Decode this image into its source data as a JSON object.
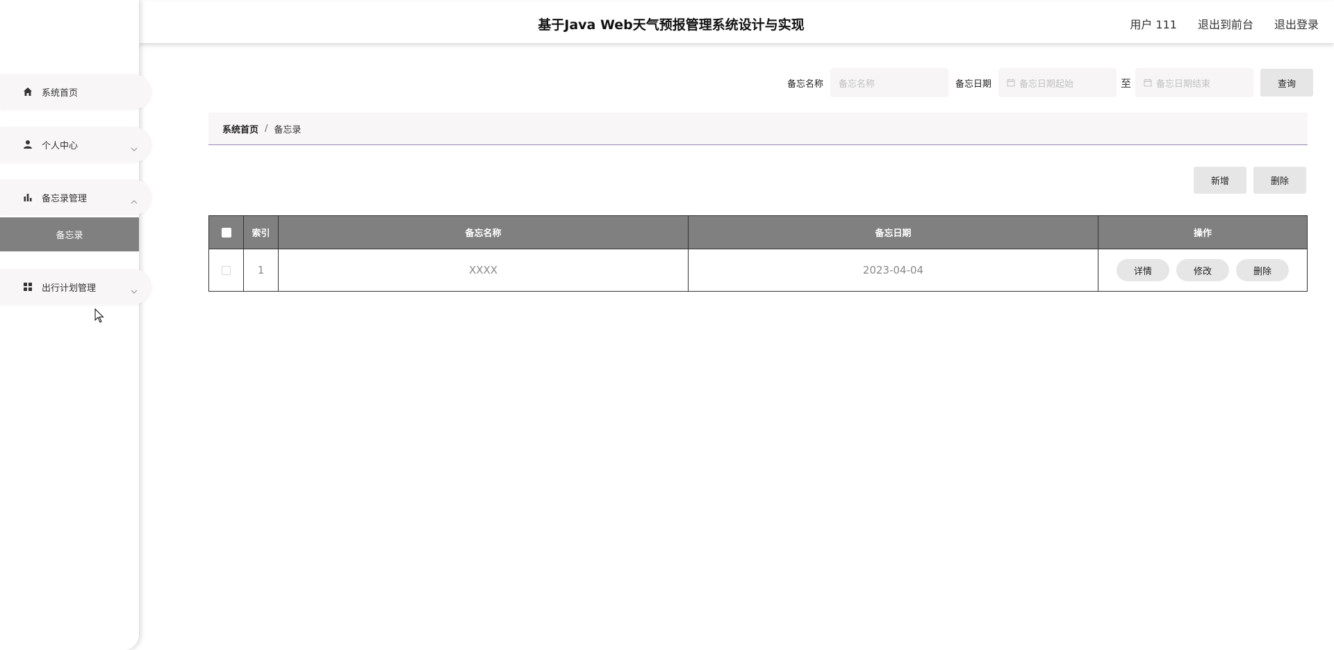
{
  "sidebar": {
    "items": [
      {
        "label": "系统首页",
        "icon": "home-icon"
      },
      {
        "label": "个人中心",
        "icon": "user-icon",
        "arrow": "chevron-down-icon"
      },
      {
        "label": "备忘录管理",
        "icon": "bar-chart-icon",
        "arrow": "chevron-up-icon",
        "children": [
          {
            "label": "备忘录",
            "active": true
          }
        ]
      },
      {
        "label": "出行计划管理",
        "icon": "grid-icon",
        "arrow": "chevron-down-icon"
      }
    ]
  },
  "header": {
    "title": "基于Java Web天气预报管理系统设计与实现",
    "user": "用户 111",
    "front_link": "退出到前台",
    "logout": "退出登录"
  },
  "search": {
    "name_label": "备忘名称",
    "name_placeholder": "备忘名称",
    "date_label": "备忘日期",
    "date_start_placeholder": "备忘日期起始",
    "to_label": "至",
    "date_end_placeholder": "备忘日期结束",
    "query_button": "查询"
  },
  "breadcrumb": {
    "home": "系统首页",
    "separator": "/",
    "current": "备忘录"
  },
  "actions": {
    "add": "新增",
    "delete": "删除"
  },
  "table": {
    "columns": [
      "索引",
      "备忘名称",
      "备忘日期",
      "操作"
    ],
    "rows": [
      {
        "index": "1",
        "name": "XXXX",
        "date": "2023-04-04"
      }
    ],
    "row_actions": {
      "detail": "详情",
      "edit": "修改",
      "delete": "删除"
    }
  },
  "colors": {
    "accent_gray": "#808080",
    "button_gray": "#e6e6e6",
    "breadcrumb_line": "#9b84b5"
  }
}
